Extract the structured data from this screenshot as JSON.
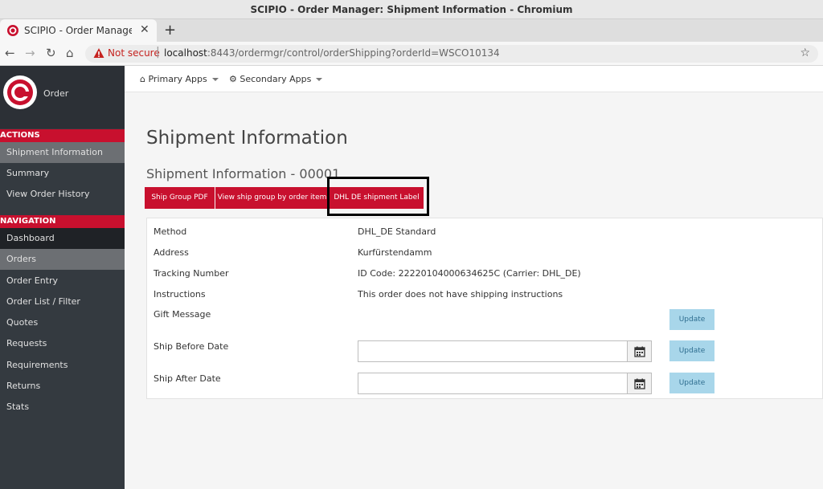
{
  "window": {
    "title": "SCIPIO - Order Manager: Shipment Information - Chromium"
  },
  "browser": {
    "tab_title": "SCIPIO - Order Manager: S",
    "tab_close": "✕",
    "new_tab": "+",
    "security_label": "Not secure",
    "url_host": "localhost",
    "url_rest": ":8443/ordermgr/control/orderShipping?orderId=WSCO10134",
    "star": "☆"
  },
  "sidebar": {
    "logo_label": "Order",
    "actions_header": "ACTIONS",
    "actions": [
      "Shipment Information",
      "Summary",
      "View Order History"
    ],
    "navigation_header": "NAVIGATION",
    "navigation": [
      "Dashboard",
      "Orders",
      "Order Entry",
      "Order List / Filter",
      "Quotes",
      "Requests",
      "Requirements",
      "Returns",
      "Stats"
    ]
  },
  "topnav": {
    "primary_apps": "Primary Apps",
    "secondary_apps": "Secondary Apps"
  },
  "main": {
    "page_title": "Shipment Information",
    "sub_title": "Shipment Information - 00001",
    "buttons": [
      "Ship Group PDF",
      "View ship group by order item",
      "DHL DE shipment Label"
    ],
    "rows": {
      "method_label": "Method",
      "method_value": "DHL_DE Standard",
      "address_label": "Address",
      "address_value": "Kurfürstendamm",
      "tracking_label": "Tracking Number",
      "tracking_value": "ID Code: 22220104000634625C (Carrier: DHL_DE)",
      "instructions_label": "Instructions",
      "instructions_value": "This order does not have shipping instructions",
      "gift_label": "Gift Message",
      "ship_before_label": "Ship Before Date",
      "ship_after_label": "Ship After Date"
    },
    "update_label": "Update"
  },
  "colors": {
    "brand_red": "#c8102e",
    "sidebar_bg": "#343a40",
    "update_btn": "#a8d6ea"
  }
}
